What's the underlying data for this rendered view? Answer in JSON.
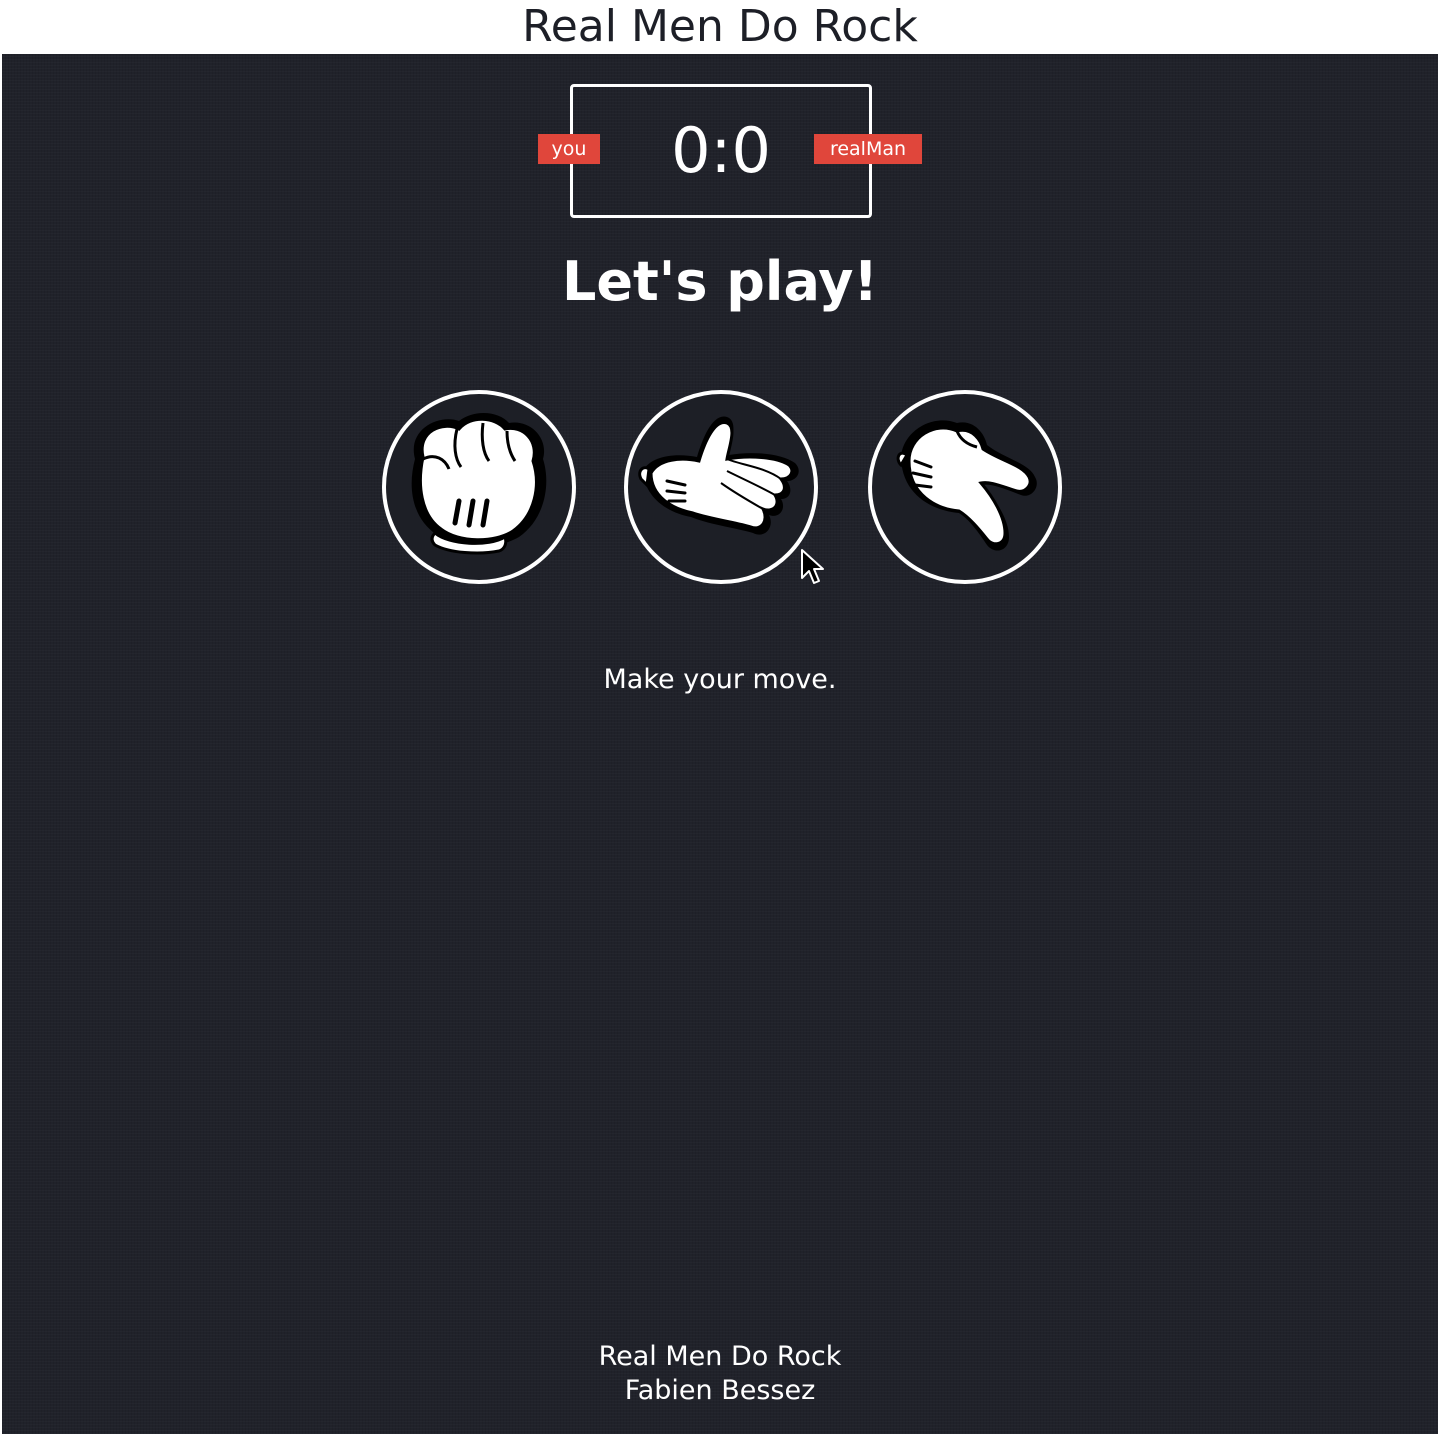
{
  "window": {
    "title": "Real Men Do Rock"
  },
  "scoreboard": {
    "score": "0:0",
    "player_tag": "you",
    "opponent_tag": "realMan",
    "tag_color": "#e0463b"
  },
  "heading": "Let's play!",
  "moves": [
    {
      "id": "rock",
      "icon": "rock-fist-icon"
    },
    {
      "id": "paper",
      "icon": "paper-hand-icon"
    },
    {
      "id": "scissors",
      "icon": "scissors-hand-icon"
    }
  ],
  "status": "Make your move.",
  "footer": {
    "title": "Real Men Do Rock",
    "author": "Fabien Bessez"
  },
  "colors": {
    "background": "#20222a",
    "foreground": "#ffffff"
  }
}
